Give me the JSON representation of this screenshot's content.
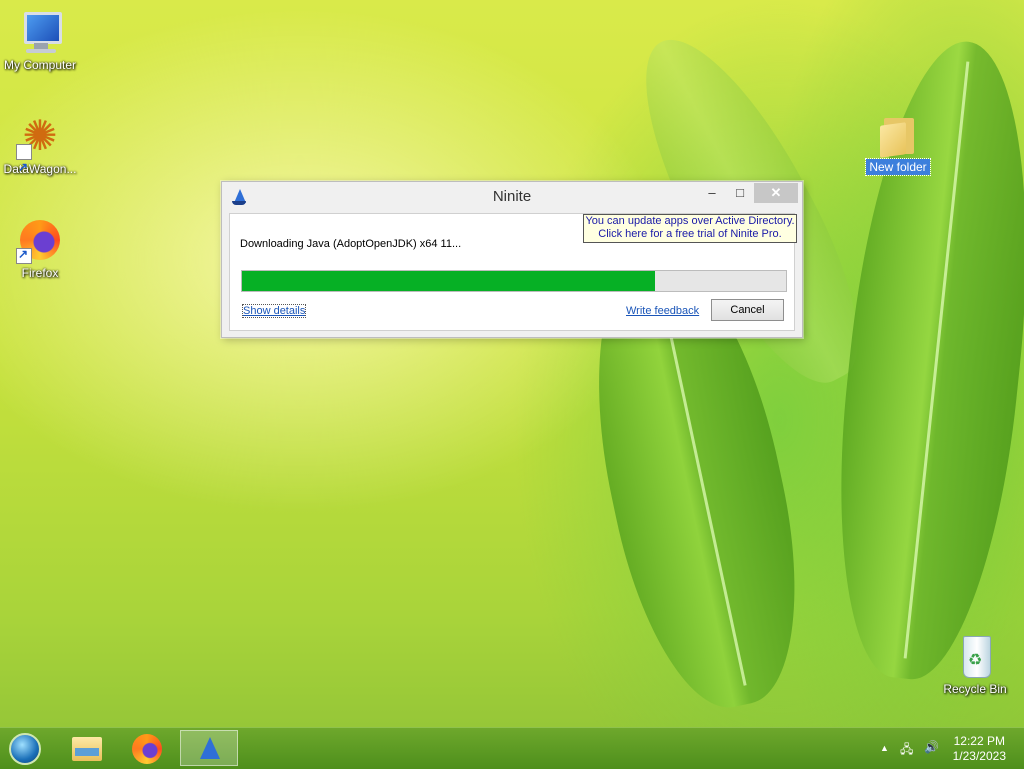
{
  "desktop": {
    "icons": [
      {
        "label": "My Computer"
      },
      {
        "label": "DataWagon..."
      },
      {
        "label": "Firefox"
      },
      {
        "label": "New folder"
      },
      {
        "label": "Recycle Bin"
      }
    ]
  },
  "window": {
    "title": "Ninite",
    "minimize_glyph": "–",
    "maximize_glyph": "□",
    "close_glyph": "✕",
    "promo_line1": "You can update apps over Active Directory.",
    "promo_line2": "Click here for a free trial of Ninite Pro.",
    "status": "Downloading Java (AdoptOpenJDK) x64 11...",
    "progress_fraction": 0.76,
    "progress_color": "#06b025",
    "show_details": "Show details",
    "write_feedback": "Write feedback",
    "cancel": "Cancel"
  },
  "taskbar": {
    "tray_up_glyph": "▲",
    "network_glyph": "🖧",
    "volume_glyph": "🔊",
    "time": "12:22 PM",
    "date": "1/23/2023"
  }
}
